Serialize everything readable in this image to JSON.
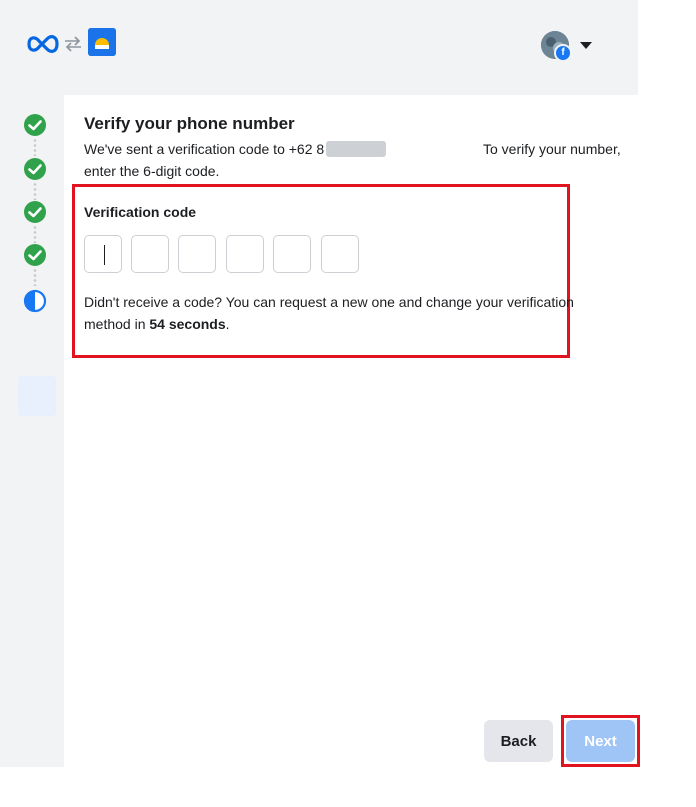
{
  "header": {
    "meta_logo_icon": "meta-infinity-icon",
    "swap_icon": "swap-arrows-icon",
    "app_logo_icon": "app-logo-icon",
    "account_avatar_icon": "avatar-icon",
    "facebook_badge_icon": "facebook-icon",
    "account_menu_icon": "caret-down-icon"
  },
  "steps": [
    {
      "status": "complete",
      "icon": "check-circle-icon"
    },
    {
      "status": "complete",
      "icon": "check-circle-icon"
    },
    {
      "status": "complete",
      "icon": "check-circle-icon"
    },
    {
      "status": "complete",
      "icon": "check-circle-icon"
    },
    {
      "status": "current",
      "icon": "half-circle-icon"
    }
  ],
  "main": {
    "title": "Verify your phone number",
    "description_prefix": "We've sent a verification code to +62 8",
    "description_suffix": "To verify your number,",
    "description_line2": "enter the 6-digit code.",
    "code_label": "Verification code",
    "code_digits": [
      "",
      "",
      "",
      "",
      "",
      ""
    ],
    "resend_text": "Didn't receive a code? You can request a new one and change your verification method in ",
    "countdown": "54 seconds",
    "resend_end": "."
  },
  "footer": {
    "back_label": "Back",
    "next_label": "Next"
  },
  "colors": {
    "brand_blue": "#1877f2",
    "success_green": "#31a24c",
    "highlight_red": "#e1131e",
    "disabled_next": "#9fc4f6"
  }
}
